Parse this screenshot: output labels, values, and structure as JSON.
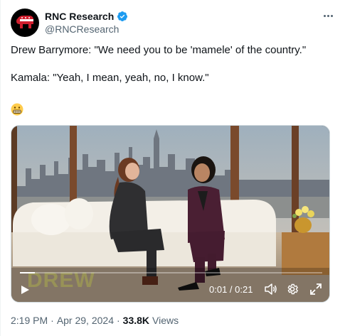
{
  "author": {
    "display_name": "RNC Research",
    "handle": "@RNCResearch",
    "verified": true,
    "avatar_icon": "gop-elephant-icon",
    "avatar_color": "#d11f2f"
  },
  "tweet": {
    "line1": "Drew Barrymore: \"We need you to be 'mamele' of the country.\"",
    "line2": "Kamala: \"Yeah, I mean, yeah, no, I know.\"",
    "emoji": "grimacing-face-icon"
  },
  "video": {
    "watermark": "DREW",
    "current_time": "0:01",
    "duration": "0:21",
    "time_display": "0:01 / 0:21",
    "progress": 0.05
  },
  "meta": {
    "time": "2:19 PM",
    "date": "Apr 29, 2024",
    "separator": "·",
    "views_count": "33.8K",
    "views_label": "Views"
  },
  "colors": {
    "accent_verified": "#1d9bf0",
    "text_secondary": "#536471"
  }
}
